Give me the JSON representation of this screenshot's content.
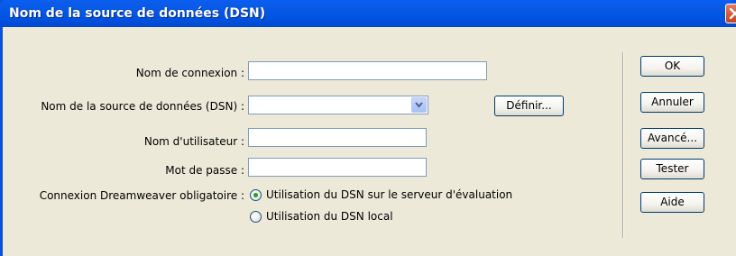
{
  "dialog": {
    "title": "Nom de la source de données (DSN)",
    "close_icon": "close-icon"
  },
  "form": {
    "connection_name_label": "Nom de connexion :",
    "connection_name_value": "",
    "dsn_label": "Nom de la source de données (DSN) :",
    "dsn_value": "",
    "define_button": "Définir...",
    "username_label": "Nom d'utilisateur :",
    "username_value": "",
    "password_label": "Mot de passe :",
    "password_value": "",
    "dw_connection_label": "Connexion Dreamweaver obligatoire :",
    "radio_options": [
      {
        "label": "Utilisation du DSN sur le serveur d'évaluation",
        "selected": true
      },
      {
        "label": "Utilisation du DSN local",
        "selected": false
      }
    ]
  },
  "buttons": {
    "ok": "OK",
    "cancel": "Annuler",
    "advanced": "Avancé...",
    "test": "Tester",
    "help": "Aide"
  },
  "colors": {
    "titlebar": "#0055e3",
    "client": "#ece9d8",
    "radio_selected": "#21a121",
    "close": "#c9401c"
  }
}
